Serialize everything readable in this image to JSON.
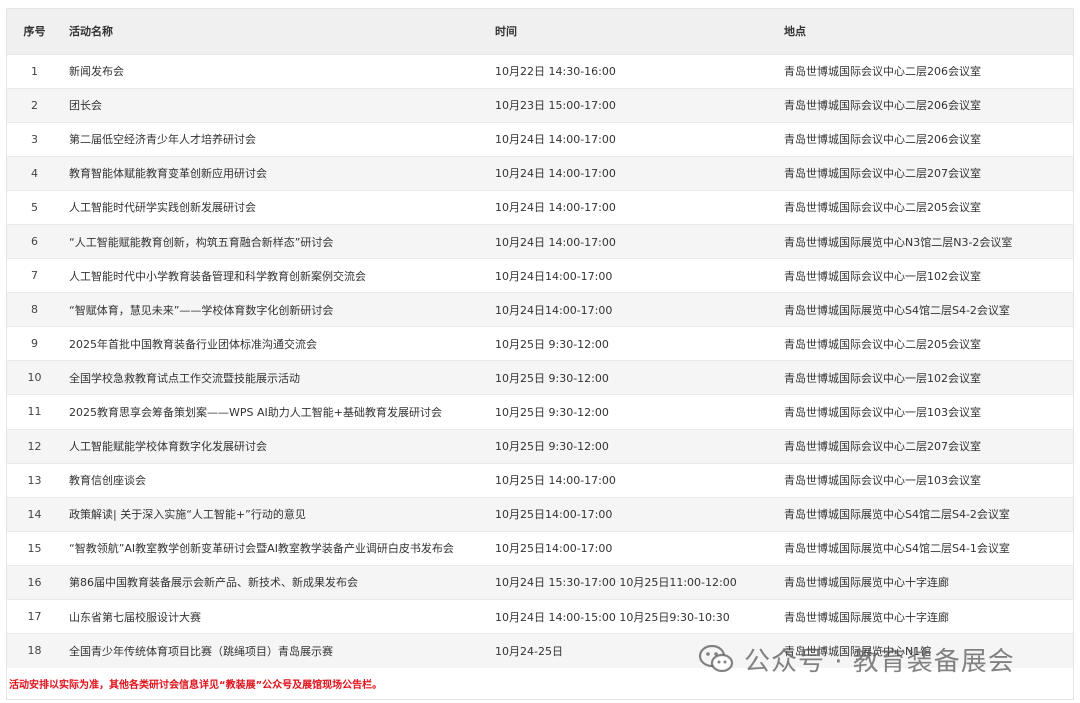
{
  "table": {
    "headers": {
      "no": "序号",
      "name": "活动名称",
      "time": "时间",
      "location": "地点"
    },
    "rows": [
      {
        "no": "1",
        "name": "新闻发布会",
        "time": "10月22日 14:30-16:00",
        "location": "青岛世博城国际会议中心二层206会议室"
      },
      {
        "no": "2",
        "name": "团长会",
        "time": "10月23日 15:00-17:00",
        "location": "青岛世博城国际会议中心二层206会议室"
      },
      {
        "no": "3",
        "name": "第二届低空经济青少年人才培养研讨会",
        "time": "10月24日 14:00-17:00",
        "location": "青岛世博城国际会议中心二层206会议室"
      },
      {
        "no": "4",
        "name": "教育智能体赋能教育变革创新应用研讨会",
        "time": "10月24日 14:00-17:00",
        "location": "青岛世博城国际会议中心二层207会议室"
      },
      {
        "no": "5",
        "name": "人工智能时代研学实践创新发展研讨会",
        "time": "10月24日 14:00-17:00",
        "location": "青岛世博城国际会议中心二层205会议室"
      },
      {
        "no": "6",
        "name": "“人工智能赋能教育创新，构筑五育融合新样态”研讨会",
        "time": "10月24日 14:00-17:00",
        "location": "青岛世博城国际展览中心N3馆二层N3-2会议室"
      },
      {
        "no": "7",
        "name": "人工智能时代中小学教育装备管理和科学教育创新案例交流会",
        "time": "10月24日14:00-17:00",
        "location": "青岛世博城国际会议中心一层102会议室"
      },
      {
        "no": "8",
        "name": "“智赋体育，慧见未来”——学校体育数字化创新研讨会",
        "time": "10月24日14:00-17:00",
        "location": "青岛世博城国际展览中心S4馆二层S4-2会议室"
      },
      {
        "no": "9",
        "name": "2025年首批中国教育装备行业团体标准沟通交流会",
        "time": "10月25日 9:30-12:00",
        "location": "青岛世博城国际会议中心二层205会议室"
      },
      {
        "no": "10",
        "name": "全国学校急救教育试点工作交流暨技能展示活动",
        "time": "10月25日 9:30-12:00",
        "location": "青岛世博城国际会议中心一层102会议室"
      },
      {
        "no": "11",
        "name": "2025教育思享会筹备策划案——WPS AI助力人工智能+基础教育发展研讨会",
        "time": "10月25日 9:30-12:00",
        "location": "青岛世博城国际会议中心一层103会议室"
      },
      {
        "no": "12",
        "name": "人工智能赋能学校体育数字化发展研讨会",
        "time": "10月25日 9:30-12:00",
        "location": "青岛世博城国际会议中心二层207会议室"
      },
      {
        "no": "13",
        "name": "教育信创座谈会",
        "time": "10月25日 14:00-17:00",
        "location": "青岛世博城国际会议中心一层103会议室"
      },
      {
        "no": "14",
        "name": "政策解读| 关于深入实施“人工智能+”行动的意见",
        "time": "10月25日14:00-17:00",
        "location": "青岛世博城国际展览中心S4馆二层S4-2会议室"
      },
      {
        "no": "15",
        "name": "“智教领航”AI教室教学创新变革研讨会暨AI教室教学装备产业调研白皮书发布会",
        "time": "10月25日14:00-17:00",
        "location": "青岛世博城国际展览中心S4馆二层S4-1会议室"
      },
      {
        "no": "16",
        "name": "第86届中国教育装备展示会新产品、新技术、新成果发布会",
        "time": "10月24日 15:30-17:00   10月25日11:00-12:00",
        "location": "青岛世博城国际展览中心十字连廊"
      },
      {
        "no": "17",
        "name": "山东省第七届校服设计大赛",
        "time": "10月24日 14:00-15:00   10月25日9:30-10:30",
        "location": "青岛世博城国际展览中心十字连廊"
      },
      {
        "no": "18",
        "name": "全国青少年传统体育项目比赛（跳绳项目）青岛展示赛",
        "time": "10月24-25日",
        "location": "青岛世博城国际展览中心N1馆"
      }
    ]
  },
  "footnote": "活动安排以实际为准，其他各类研讨会信息详见“教装展”公众号及展馆现场公告栏。",
  "watermark": {
    "text": "公众号 · 教育装备展会",
    "icon": "wechat-icon"
  },
  "colors": {
    "header_bg": "#f0f0f0",
    "row_alt_bg": "#f5f5f5",
    "footnote": "#e0121c"
  }
}
